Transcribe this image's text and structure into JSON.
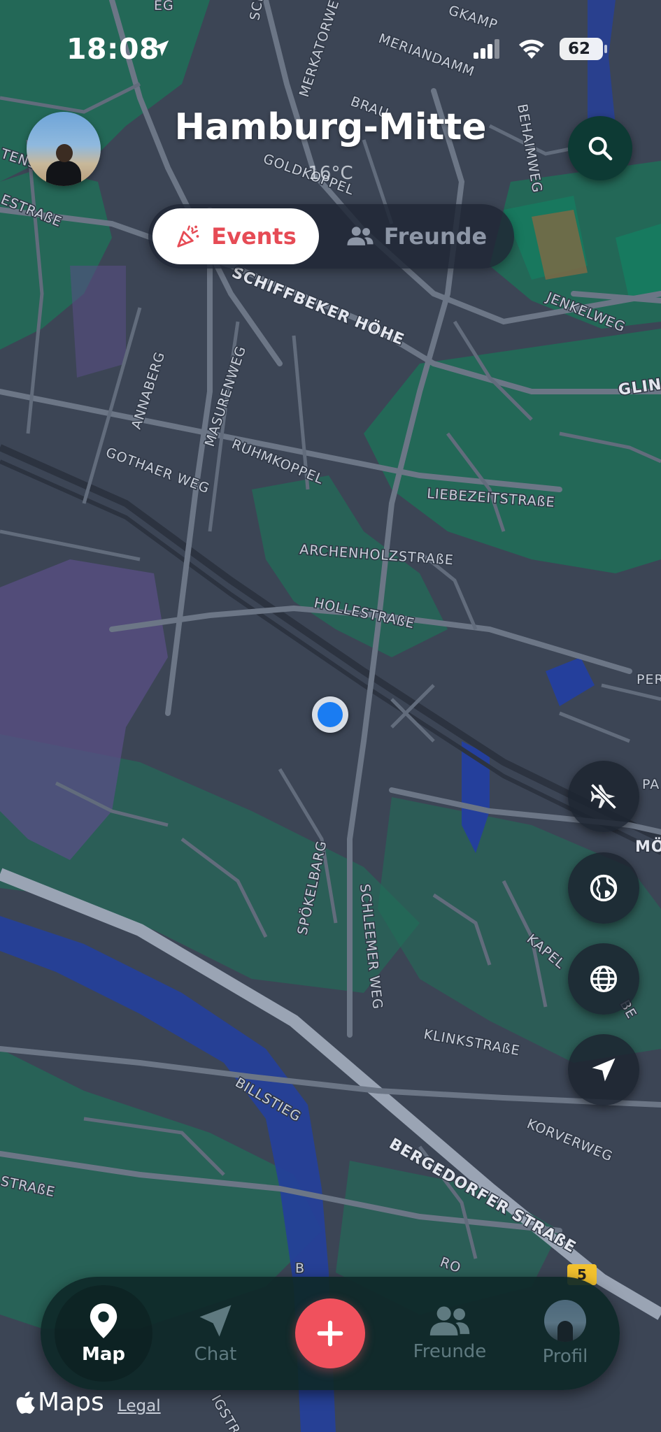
{
  "status_bar": {
    "time": "18:08",
    "battery": "62"
  },
  "header": {
    "city": "Hamburg-Mitte",
    "temperature": "16°C"
  },
  "segment": {
    "events_label": "Events",
    "friends_label": "Freunde",
    "selected": "Events"
  },
  "map": {
    "street_labels": {
      "merkatorweg": "MERKATORWEG",
      "meriandamm": "MERIANDAMM",
      "braunschweig": "BRAU",
      "goldkoppel": "GOLDKOPPEL",
      "behaimweg": "BEHAIMWEG",
      "strasse_left": "ESTRAßE",
      "tens": "TENS",
      "schiffbeker": "SCHIFFBEKER HÖHE",
      "jenkelweg": "JENKELWEG",
      "glin": "GLIN",
      "annaberg": "ANNABERG",
      "masurenweg": "MASURENWEG",
      "ruhmkoppel": "RUHMKOPPEL",
      "gothaer": "GOTHAER WEG",
      "liebezeit": "LIEBEZEITSTRAßE",
      "archenholz": "ARCHENHOLZSTRAßE",
      "holle": "HOLLESTRAßE",
      "per": "PER",
      "pa": "PA",
      "mo": "MÖ",
      "spoekelbarg": "SPÖKELBARG",
      "schleemer": "SCHLEEMER WEG",
      "kapel": "KAPEL",
      "be": "BE",
      "klinkstrasse": "KLINKSTRAßE",
      "billstieg": "BILLSTIEG",
      "korverweg": "KORVERWEG",
      "bergedorfer": "BERGEDORFER STRAßE",
      "strasse_bottom": "STRAßE",
      "ro": "RO",
      "b": "B",
      "igstr": "IGSTR",
      "gkamp": "GKAMP",
      "eg": "EG",
      "sch": "SCH"
    },
    "route_number": "5",
    "colors": {
      "land": "#3c4555",
      "green": "#1f6f58",
      "park": "#177a5f",
      "water": "#243f9c",
      "road": "#6c7686",
      "highway": "#9aa4b4",
      "user_dot": "#1a7cf2"
    }
  },
  "side_controls": {
    "buttons": [
      "no-flight-icon",
      "globe-half-icon",
      "globe-grid-icon",
      "navigation-arrow-icon"
    ]
  },
  "tabbar": {
    "map": "Map",
    "chat": "Chat",
    "friends": "Freunde",
    "profile": "Profil",
    "accent": "#f0515d"
  },
  "footer": {
    "maps": "Maps",
    "legal": "Legal"
  }
}
